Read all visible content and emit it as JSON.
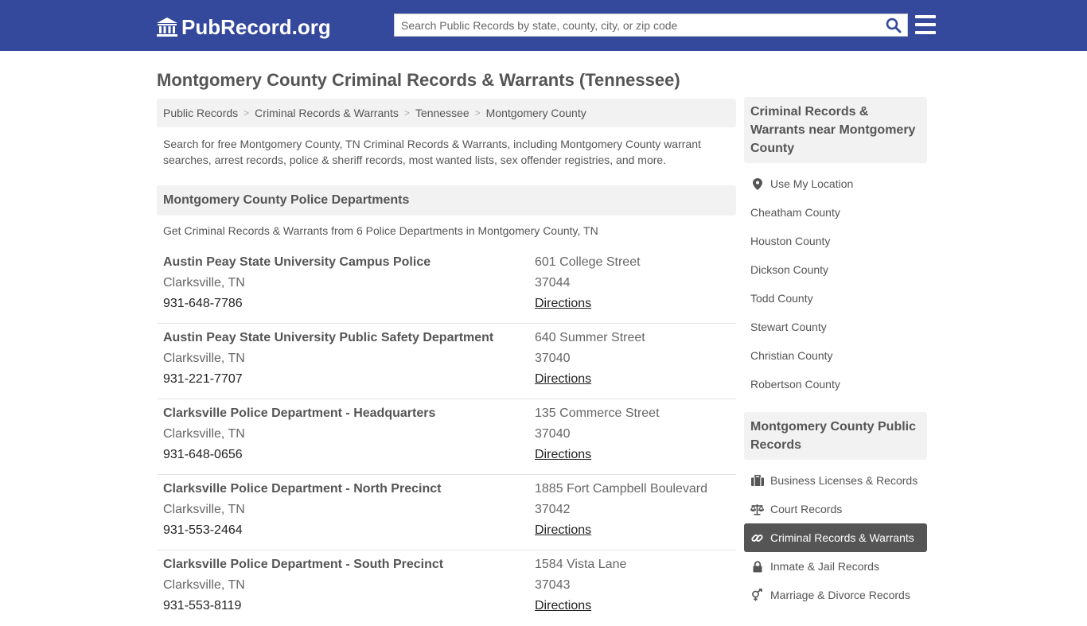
{
  "brand": {
    "name": "PubRecord.org"
  },
  "search": {
    "placeholder": "Search Public Records by state, county, city, or zip code"
  },
  "page_title": "Montgomery County Criminal Records & Warrants (Tennessee)",
  "breadcrumb": [
    {
      "label": "Public Records"
    },
    {
      "label": "Criminal Records & Warrants"
    },
    {
      "label": "Tennessee"
    },
    {
      "label": "Montgomery County"
    }
  ],
  "breadcrumb_sep": ">",
  "intro": "Search for free Montgomery County, TN Criminal Records & Warrants, including Montgomery County warrant searches, arrest records, police & sheriff records, most wanted lists, sex offender registries, and more.",
  "section": {
    "title": "Montgomery County Police Departments",
    "subtitle": "Get Criminal Records & Warrants from 6 Police Departments in Montgomery County, TN"
  },
  "departments": [
    {
      "name": "Austin Peay State University Campus Police",
      "city": "Clarksville, TN",
      "phone": "931-648-7786",
      "street": "601 College Street",
      "zip": "37044",
      "directions": "Directions"
    },
    {
      "name": "Austin Peay State University Public Safety Department",
      "city": "Clarksville, TN",
      "phone": "931-221-7707",
      "street": "640 Summer Street",
      "zip": "37040",
      "directions": "Directions"
    },
    {
      "name": "Clarksville Police Department - Headquarters",
      "city": "Clarksville, TN",
      "phone": "931-648-0656",
      "street": "135 Commerce Street",
      "zip": "37040",
      "directions": "Directions"
    },
    {
      "name": "Clarksville Police Department - North Precinct",
      "city": "Clarksville, TN",
      "phone": "931-553-2464",
      "street": "1885 Fort Campbell Boulevard",
      "zip": "37042",
      "directions": "Directions"
    },
    {
      "name": "Clarksville Police Department - South Precinct",
      "city": "Clarksville, TN",
      "phone": "931-553-8119",
      "street": "1584 Vista Lane",
      "zip": "37043",
      "directions": "Directions"
    }
  ],
  "sidebar": {
    "nearby": {
      "title": "Criminal Records & Warrants near Montgomery County",
      "items": [
        {
          "label": "Use My Location",
          "icon": "map-marker-icon"
        },
        {
          "label": "Cheatham County"
        },
        {
          "label": "Houston County"
        },
        {
          "label": "Dickson County"
        },
        {
          "label": "Todd County"
        },
        {
          "label": "Stewart County"
        },
        {
          "label": "Christian County"
        },
        {
          "label": "Robertson County"
        }
      ]
    },
    "records": {
      "title": "Montgomery County Public Records",
      "items": [
        {
          "label": "Business Licenses & Records",
          "icon": "briefcase-icon"
        },
        {
          "label": "Court Records",
          "icon": "scales-icon"
        },
        {
          "label": "Criminal Records & Warrants",
          "icon": "link-icon",
          "active": true
        },
        {
          "label": "Inmate & Jail Records",
          "icon": "lock-icon"
        },
        {
          "label": "Marriage & Divorce Records",
          "icon": "gender-icon"
        }
      ]
    }
  },
  "colors": {
    "header_bg": "#34489c",
    "active_bg": "#555555",
    "panel_bg": "#f2f2f2"
  }
}
